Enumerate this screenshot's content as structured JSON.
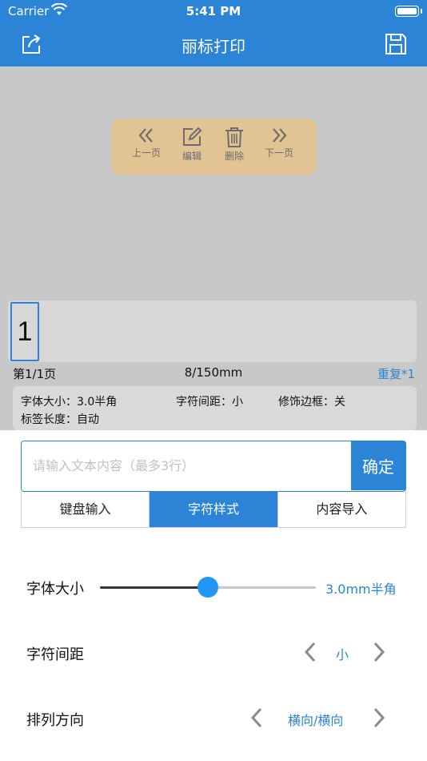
{
  "status_bar": {
    "carrier": "Carrier",
    "time": "5:41 PM"
  },
  "nav": {
    "title": "丽标打印"
  },
  "toolbar": {
    "prev": "上一页",
    "edit": "编辑",
    "delete": "删除",
    "next": "下一页"
  },
  "label": {
    "cell_text": "1"
  },
  "info": {
    "page": "第1/1页",
    "length": "8/150mm",
    "repeat": "重复*1"
  },
  "settings": {
    "font_size": "字体大小：3.0半角",
    "char_spacing": "字符间距：小",
    "border": "修饰边框：关",
    "label_length": "标签长度：自动"
  },
  "input": {
    "placeholder": "请输入文本内容（最多3行）",
    "value": "",
    "confirm": "确定"
  },
  "tabs": [
    {
      "label": "键盘输入",
      "active": false
    },
    {
      "label": "字符样式",
      "active": true
    },
    {
      "label": "内容导入",
      "active": false
    }
  ],
  "style_panel": {
    "font_size": {
      "label": "字体大小",
      "value": "3.0mm半角",
      "slider_fraction": 0.5
    },
    "char_spacing": {
      "label": "字符间距",
      "value": "小"
    },
    "direction": {
      "label": "排列方向",
      "value": "横向/横向"
    }
  },
  "colors": {
    "accent": "#2b84d6",
    "toolbar_bg": "#e2c393",
    "preview_bg": "#c8c8c8"
  }
}
